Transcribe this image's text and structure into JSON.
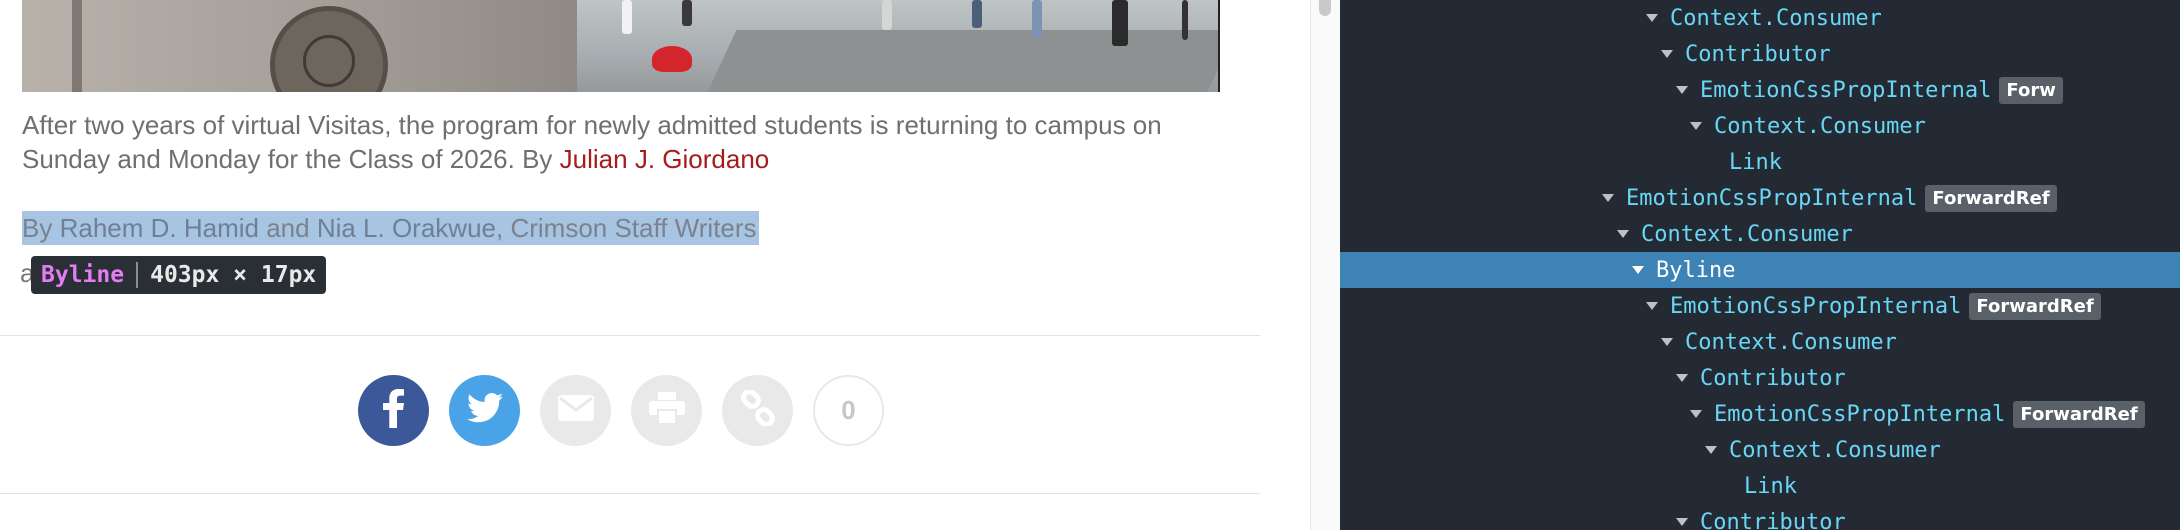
{
  "article": {
    "caption_text": "After two years of virtual Visitas, the program for newly admitted students is returning to campus on Sunday and Monday for the Class of 2026. By ",
    "caption_author": "Julian J. Giordano",
    "byline": {
      "prefix": "By ",
      "author1": "Rahem D. Hamid",
      "and": " and ",
      "author2": "Nia L. Orakwue",
      "suffix": ", Crimson Staff Writers"
    },
    "stray_text": "a",
    "inspect_tooltip": {
      "name": "Byline",
      "size": "403px × 17px"
    },
    "share": {
      "buttons": [
        {
          "name": "facebook-share-button",
          "icon": "facebook-icon",
          "color": "#3b5998"
        },
        {
          "name": "twitter-share-button",
          "icon": "twitter-icon",
          "color": "#4aa3e6"
        },
        {
          "name": "email-share-button",
          "icon": "mail-icon",
          "color": "#e9e9e9"
        },
        {
          "name": "print-button",
          "icon": "print-icon",
          "color": "#e9e9e9"
        },
        {
          "name": "copy-link-button",
          "icon": "link-icon",
          "color": "#e9e9e9"
        }
      ],
      "count": "0"
    }
  },
  "devtools": {
    "tree": [
      {
        "name": "Context.Consumer",
        "depth": 6,
        "arrow": true
      },
      {
        "name": "Contributor",
        "depth": 7,
        "arrow": true
      },
      {
        "name": "EmotionCssPropInternal",
        "depth": 8,
        "arrow": true,
        "badge": "Forw"
      },
      {
        "name": "Context.Consumer",
        "depth": 9,
        "arrow": true
      },
      {
        "name": "Link",
        "depth": 10,
        "arrow": false
      },
      {
        "name": "EmotionCssPropInternal",
        "depth": 3,
        "arrow": true,
        "badge": "ForwardRef"
      },
      {
        "name": "Context.Consumer",
        "depth": 4,
        "arrow": true
      },
      {
        "name": "Byline",
        "depth": 5,
        "arrow": true,
        "selected": true
      },
      {
        "name": "EmotionCssPropInternal",
        "depth": 6,
        "arrow": true,
        "badge": "ForwardRef"
      },
      {
        "name": "Context.Consumer",
        "depth": 7,
        "arrow": true
      },
      {
        "name": "Contributor",
        "depth": 8,
        "arrow": true
      },
      {
        "name": "EmotionCssPropInternal",
        "depth": 9,
        "arrow": true,
        "badge": "ForwardRef"
      },
      {
        "name": "Context.Consumer",
        "depth": 10,
        "arrow": true
      },
      {
        "name": "Link",
        "depth": 11,
        "arrow": false
      },
      {
        "name": "Contributor",
        "depth": 8,
        "arrow": true
      }
    ],
    "colors": {
      "background": "#242a33",
      "component": "#69d6f5",
      "selected_row": "#3d83b5"
    }
  }
}
